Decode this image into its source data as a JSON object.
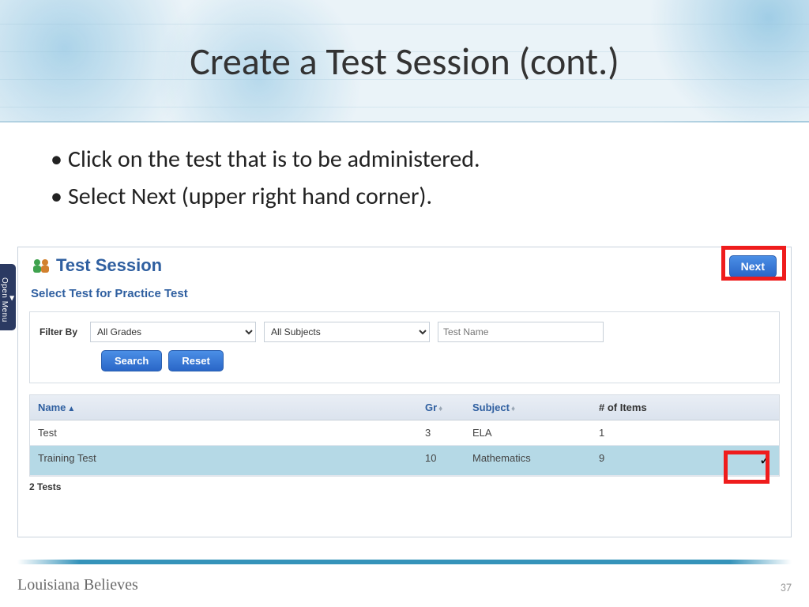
{
  "slide": {
    "title": "Create a Test Session (cont.)",
    "bullets": [
      "Click on the test that is to be administered.",
      "Select Next (upper right hand corner)."
    ],
    "brand": "Louisiana Believes",
    "page_number": "37"
  },
  "open_menu_label": "Open Menu",
  "app": {
    "title": "Test Session",
    "subtitle": "Select Test for Practice Test",
    "next_label": "Next",
    "filter": {
      "label": "Filter By",
      "grades_selected": "All Grades",
      "subjects_selected": "All Subjects",
      "name_placeholder": "Test Name",
      "search_label": "Search",
      "reset_label": "Reset"
    },
    "columns": {
      "name": "Name",
      "gr": "Gr",
      "subject": "Subject",
      "items": "# of Items"
    },
    "rows": [
      {
        "name": "Test",
        "gr": "3",
        "subject": "ELA",
        "items": "1",
        "selected": false
      },
      {
        "name": "Training Test",
        "gr": "10",
        "subject": "Mathematics",
        "items": "9",
        "selected": true
      }
    ],
    "footer_count": "2 Tests"
  }
}
